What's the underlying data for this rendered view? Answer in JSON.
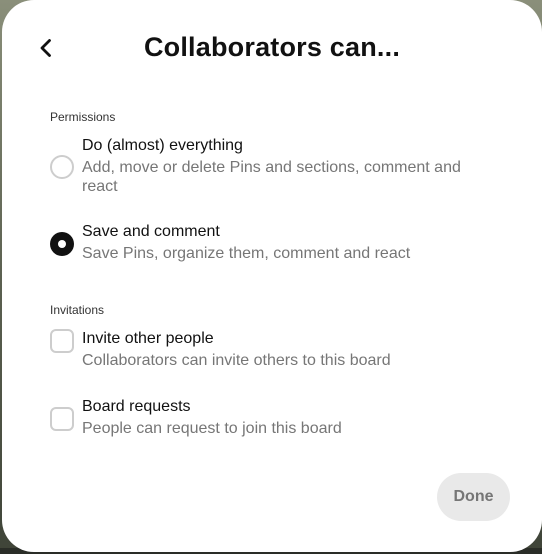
{
  "dialog": {
    "title": "Collaborators can...",
    "back_icon": "chevron-left-icon"
  },
  "permissions": {
    "label": "Permissions",
    "options": [
      {
        "title": "Do (almost) everything",
        "description": "Add, move or delete Pins and sections, comment and react",
        "selected": false
      },
      {
        "title": "Save and comment",
        "description": "Save Pins, organize them, comment and react",
        "selected": true
      }
    ]
  },
  "invitations": {
    "label": "Invitations",
    "options": [
      {
        "title": "Invite other people",
        "description": "Collaborators can invite others to this board",
        "checked": false
      },
      {
        "title": "Board requests",
        "description": "People can request to join this board",
        "checked": false
      }
    ]
  },
  "footer": {
    "done_label": "Done"
  },
  "colors": {
    "text_primary": "#111111",
    "text_secondary": "#767676",
    "control_border": "#cdcdcd",
    "done_bg": "#e9e9e9"
  }
}
